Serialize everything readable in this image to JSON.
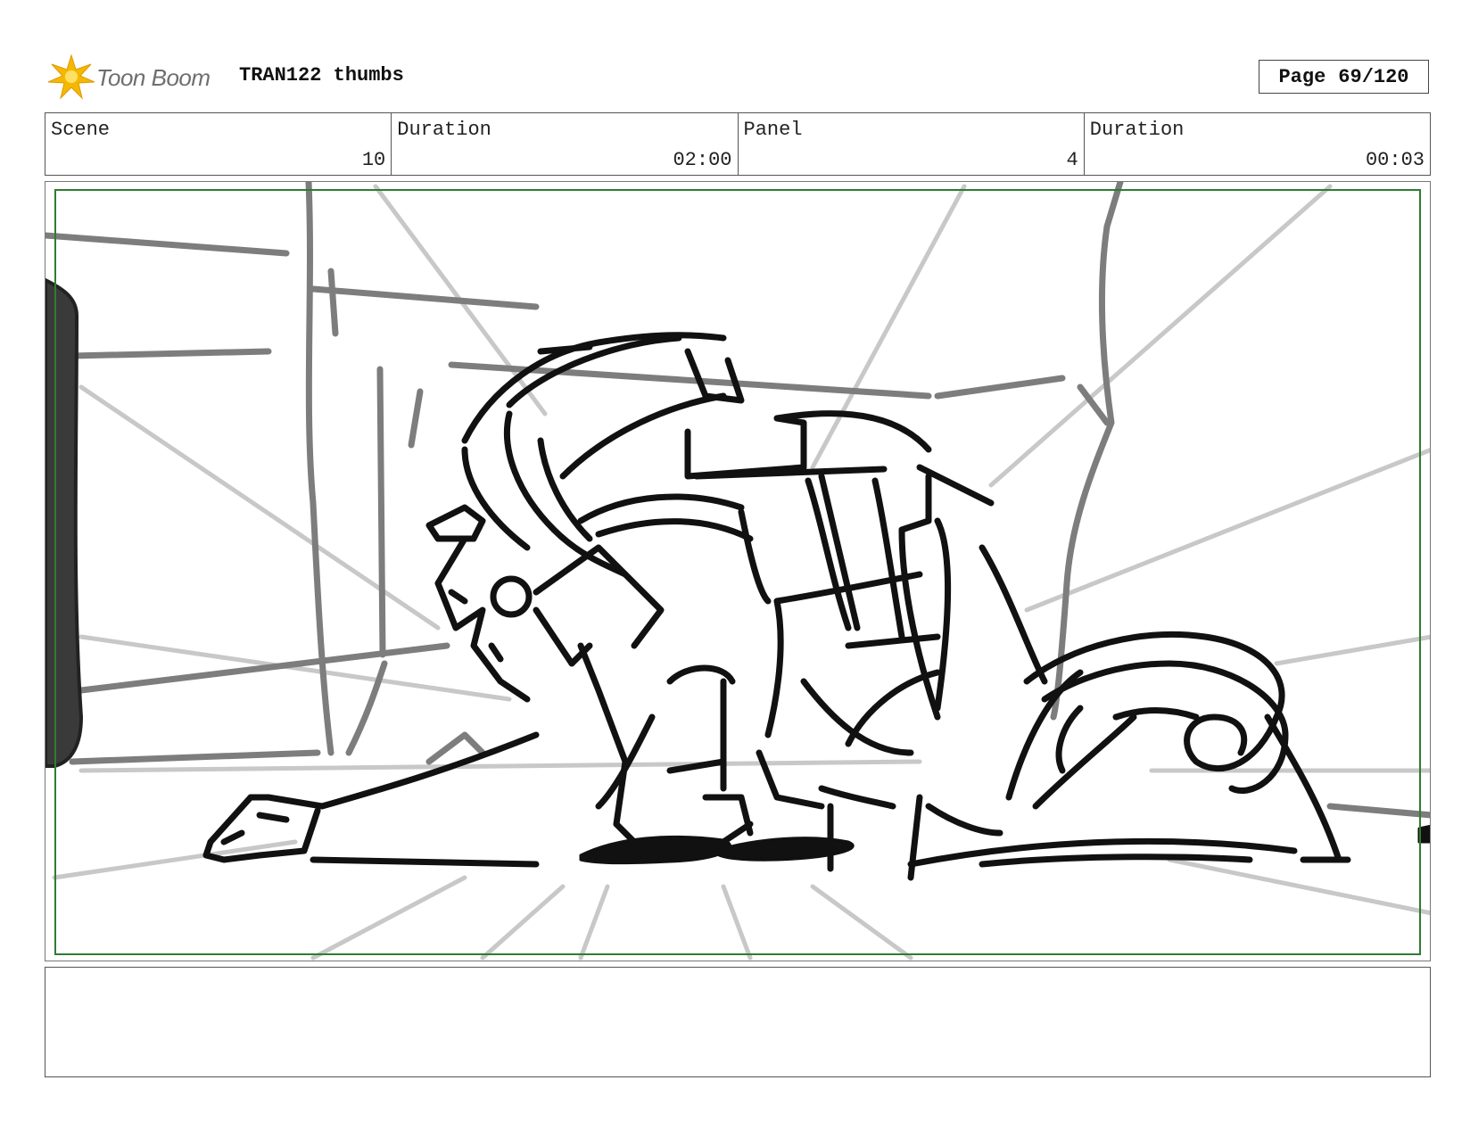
{
  "header": {
    "logo_text": "Toon Boom",
    "title": "TRAN122 thumbs",
    "page_label": "Page",
    "page_value": "69/120"
  },
  "info": [
    {
      "label": "Scene",
      "value": "10"
    },
    {
      "label": "Duration",
      "value": "02:00"
    },
    {
      "label": "Panel",
      "value": "4"
    },
    {
      "label": "Duration",
      "value": "00:03"
    }
  ],
  "colors": {
    "safe_frame": "#2e7d32",
    "logo_star": "#f5b800"
  },
  "notes": {
    "text": ""
  }
}
